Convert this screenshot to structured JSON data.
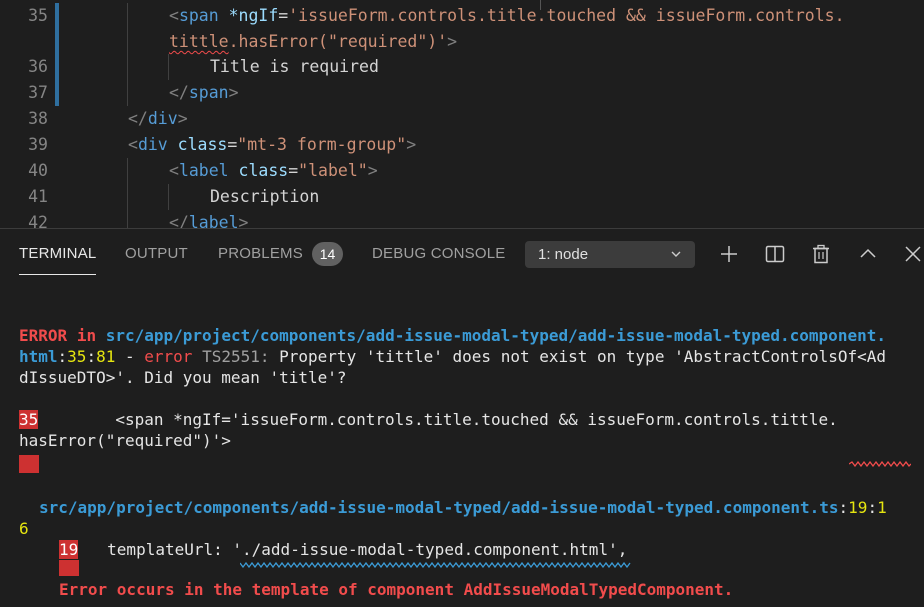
{
  "editor": {
    "lines": [
      {
        "num": "35",
        "modified": true,
        "indent": 2,
        "segments": [
          {
            "t": "<",
            "c": "g"
          },
          {
            "t": "span",
            "c": "t"
          },
          {
            "t": " *ngIf",
            "c": "a"
          },
          {
            "t": "=",
            "c": "w"
          },
          {
            "t": "'issueForm.controls.title.touched && issueForm.controls.",
            "c": "s"
          }
        ]
      },
      {
        "num": "",
        "modified": true,
        "indent": 2,
        "segments": [
          {
            "t": "tittle",
            "c": "s squig"
          },
          {
            "t": ".hasError(\"required\")'",
            "c": "s"
          },
          {
            "t": ">",
            "c": "g"
          }
        ]
      },
      {
        "num": "36",
        "modified": true,
        "indent": 3,
        "segments": [
          {
            "t": "Title is required",
            "c": "w"
          }
        ]
      },
      {
        "num": "37",
        "modified": true,
        "indent": 2,
        "segments": [
          {
            "t": "</",
            "c": "g"
          },
          {
            "t": "span",
            "c": "t"
          },
          {
            "t": ">",
            "c": "g"
          }
        ]
      },
      {
        "num": "38",
        "modified": false,
        "indent": 1,
        "segments": [
          {
            "t": "</",
            "c": "g"
          },
          {
            "t": "div",
            "c": "t"
          },
          {
            "t": ">",
            "c": "g"
          }
        ]
      },
      {
        "num": "39",
        "modified": false,
        "indent": 1,
        "segments": [
          {
            "t": "<",
            "c": "g"
          },
          {
            "t": "div",
            "c": "t"
          },
          {
            "t": " class",
            "c": "a"
          },
          {
            "t": "=",
            "c": "w"
          },
          {
            "t": "\"mt-3 form-group\"",
            "c": "s"
          },
          {
            "t": ">",
            "c": "g"
          }
        ]
      },
      {
        "num": "40",
        "modified": false,
        "indent": 2,
        "segments": [
          {
            "t": "<",
            "c": "g"
          },
          {
            "t": "label",
            "c": "t"
          },
          {
            "t": " class",
            "c": "a"
          },
          {
            "t": "=",
            "c": "w"
          },
          {
            "t": "\"label\"",
            "c": "s"
          },
          {
            "t": ">",
            "c": "g"
          }
        ]
      },
      {
        "num": "41",
        "modified": false,
        "indent": 3,
        "segments": [
          {
            "t": "Description",
            "c": "w"
          }
        ]
      },
      {
        "num": "42",
        "modified": false,
        "indent": 2,
        "segments": [
          {
            "t": "</",
            "c": "g"
          },
          {
            "t": "label",
            "c": "t"
          },
          {
            "t": ">",
            "c": "g"
          }
        ]
      }
    ]
  },
  "panel": {
    "tabs": {
      "terminal": "TERMINAL",
      "output": "OUTPUT",
      "problems": "PROBLEMS",
      "problems_count": "14",
      "debug_console": "DEBUG CONSOLE"
    },
    "terminal_select": "1: node",
    "icons": [
      "plus-icon",
      "split-terminal-icon",
      "trash-icon",
      "chevron-up-icon",
      "close-icon"
    ]
  },
  "terminal": {
    "error_word": "ERROR",
    "in_word": "in",
    "error_path_1": "src/app/project/components/add-issue-modal-typed/add-issue-modal-typed.component.",
    "error_path_2": "html",
    "error_line": "35",
    "error_col": "81",
    "dash": " - ",
    "error_label": "error",
    "error_code": "TS2551:",
    "error_msg_1": " Property 'tittle' does not exist on type 'AbstractControlsOf<Ad",
    "error_msg_2": "dIssueDTO>'. Did you mean 'title'?",
    "snippet_line_num": "35",
    "snippet_1": "        <span *ngIf='issueForm.controls.title.touched && issueForm.controls.tittle.",
    "snippet_2": "hasError(\"required\")'>",
    "ref_path": "src/app/project/components/add-issue-modal-typed/add-issue-modal-typed.component.ts",
    "ref_line": "19",
    "ref_col_1": "1",
    "ref_col_2": "6",
    "ref_line_num": "19",
    "ref_code": "   templateUrl: './add-issue-modal-typed.component.html',",
    "ref_error": "Error occurs in the template of component AddIssueModalTypedComponent."
  }
}
